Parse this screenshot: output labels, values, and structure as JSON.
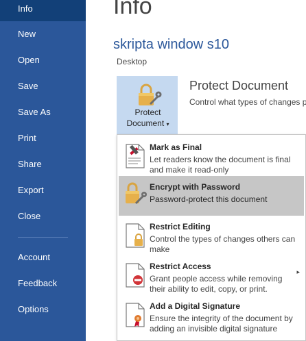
{
  "sidebar": {
    "items": [
      {
        "label": "Info",
        "active": true
      },
      {
        "label": "New"
      },
      {
        "label": "Open"
      },
      {
        "label": "Save"
      },
      {
        "label": "Save As"
      },
      {
        "label": "Print"
      },
      {
        "label": "Share"
      },
      {
        "label": "Export"
      },
      {
        "label": "Close"
      },
      {
        "label": "Account"
      },
      {
        "label": "Feedback"
      },
      {
        "label": "Options"
      }
    ]
  },
  "main": {
    "page_title": "Info",
    "document_name": "skripta window s10",
    "document_location": "Desktop",
    "protect": {
      "button_line1": "Protect",
      "button_line2": "Document",
      "dropdown_glyph": "▾",
      "heading": "Protect Document",
      "description": "Control what types of changes p"
    }
  },
  "menu": {
    "items": [
      {
        "title": "Mark as Final",
        "description": "Let readers know the document is final and make it read-only",
        "icon": "mark-final-icon"
      },
      {
        "title": "Encrypt with Password",
        "description": "Password-protect this document",
        "icon": "lock-key-icon",
        "highlighted": true
      },
      {
        "title": "Restrict Editing",
        "description": "Control the types of changes others can make",
        "icon": "doc-lock-icon"
      },
      {
        "title": "Restrict Access",
        "description": "Grant people access while removing their ability to edit, copy, or print.",
        "icon": "doc-restrict-icon",
        "has_submenu": true
      },
      {
        "title": "Add a Digital Signature",
        "description": "Ensure the integrity of the document by adding an invisible digital signature",
        "icon": "doc-ribbon-icon"
      }
    ],
    "submenu_glyph": "▸"
  },
  "colors": {
    "sidebar_bg": "#2b579a",
    "sidebar_active": "#124078",
    "accent_title": "#2b579a",
    "protect_button_bg": "#c5d9f0",
    "menu_highlight": "#c6c6c6",
    "lock_gold": "#e6b04b"
  }
}
